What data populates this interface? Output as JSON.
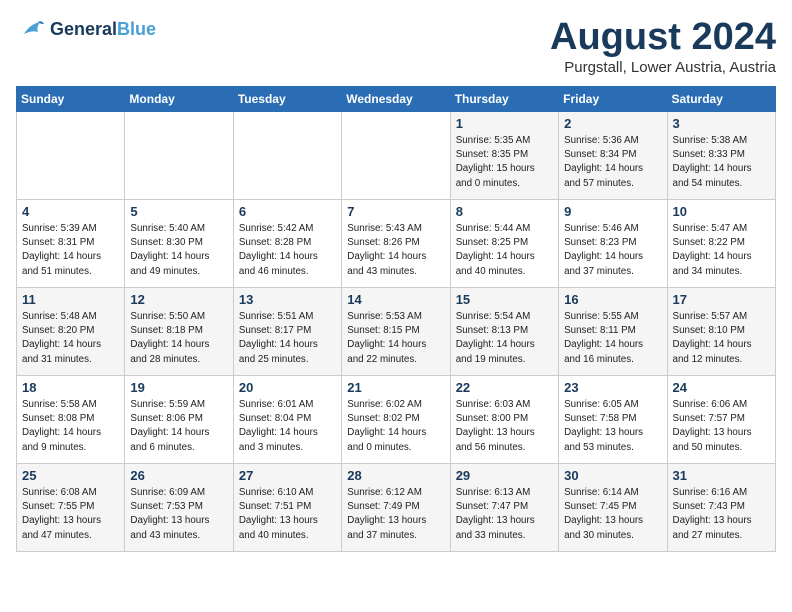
{
  "logo": {
    "line1": "General",
    "line2": "Blue"
  },
  "title": "August 2024",
  "subtitle": "Purgstall, Lower Austria, Austria",
  "weekdays": [
    "Sunday",
    "Monday",
    "Tuesday",
    "Wednesday",
    "Thursday",
    "Friday",
    "Saturday"
  ],
  "weeks": [
    [
      {
        "day": "",
        "info": ""
      },
      {
        "day": "",
        "info": ""
      },
      {
        "day": "",
        "info": ""
      },
      {
        "day": "",
        "info": ""
      },
      {
        "day": "1",
        "info": "Sunrise: 5:35 AM\nSunset: 8:35 PM\nDaylight: 15 hours\nand 0 minutes."
      },
      {
        "day": "2",
        "info": "Sunrise: 5:36 AM\nSunset: 8:34 PM\nDaylight: 14 hours\nand 57 minutes."
      },
      {
        "day": "3",
        "info": "Sunrise: 5:38 AM\nSunset: 8:33 PM\nDaylight: 14 hours\nand 54 minutes."
      }
    ],
    [
      {
        "day": "4",
        "info": "Sunrise: 5:39 AM\nSunset: 8:31 PM\nDaylight: 14 hours\nand 51 minutes."
      },
      {
        "day": "5",
        "info": "Sunrise: 5:40 AM\nSunset: 8:30 PM\nDaylight: 14 hours\nand 49 minutes."
      },
      {
        "day": "6",
        "info": "Sunrise: 5:42 AM\nSunset: 8:28 PM\nDaylight: 14 hours\nand 46 minutes."
      },
      {
        "day": "7",
        "info": "Sunrise: 5:43 AM\nSunset: 8:26 PM\nDaylight: 14 hours\nand 43 minutes."
      },
      {
        "day": "8",
        "info": "Sunrise: 5:44 AM\nSunset: 8:25 PM\nDaylight: 14 hours\nand 40 minutes."
      },
      {
        "day": "9",
        "info": "Sunrise: 5:46 AM\nSunset: 8:23 PM\nDaylight: 14 hours\nand 37 minutes."
      },
      {
        "day": "10",
        "info": "Sunrise: 5:47 AM\nSunset: 8:22 PM\nDaylight: 14 hours\nand 34 minutes."
      }
    ],
    [
      {
        "day": "11",
        "info": "Sunrise: 5:48 AM\nSunset: 8:20 PM\nDaylight: 14 hours\nand 31 minutes."
      },
      {
        "day": "12",
        "info": "Sunrise: 5:50 AM\nSunset: 8:18 PM\nDaylight: 14 hours\nand 28 minutes."
      },
      {
        "day": "13",
        "info": "Sunrise: 5:51 AM\nSunset: 8:17 PM\nDaylight: 14 hours\nand 25 minutes."
      },
      {
        "day": "14",
        "info": "Sunrise: 5:53 AM\nSunset: 8:15 PM\nDaylight: 14 hours\nand 22 minutes."
      },
      {
        "day": "15",
        "info": "Sunrise: 5:54 AM\nSunset: 8:13 PM\nDaylight: 14 hours\nand 19 minutes."
      },
      {
        "day": "16",
        "info": "Sunrise: 5:55 AM\nSunset: 8:11 PM\nDaylight: 14 hours\nand 16 minutes."
      },
      {
        "day": "17",
        "info": "Sunrise: 5:57 AM\nSunset: 8:10 PM\nDaylight: 14 hours\nand 12 minutes."
      }
    ],
    [
      {
        "day": "18",
        "info": "Sunrise: 5:58 AM\nSunset: 8:08 PM\nDaylight: 14 hours\nand 9 minutes."
      },
      {
        "day": "19",
        "info": "Sunrise: 5:59 AM\nSunset: 8:06 PM\nDaylight: 14 hours\nand 6 minutes."
      },
      {
        "day": "20",
        "info": "Sunrise: 6:01 AM\nSunset: 8:04 PM\nDaylight: 14 hours\nand 3 minutes."
      },
      {
        "day": "21",
        "info": "Sunrise: 6:02 AM\nSunset: 8:02 PM\nDaylight: 14 hours\nand 0 minutes."
      },
      {
        "day": "22",
        "info": "Sunrise: 6:03 AM\nSunset: 8:00 PM\nDaylight: 13 hours\nand 56 minutes."
      },
      {
        "day": "23",
        "info": "Sunrise: 6:05 AM\nSunset: 7:58 PM\nDaylight: 13 hours\nand 53 minutes."
      },
      {
        "day": "24",
        "info": "Sunrise: 6:06 AM\nSunset: 7:57 PM\nDaylight: 13 hours\nand 50 minutes."
      }
    ],
    [
      {
        "day": "25",
        "info": "Sunrise: 6:08 AM\nSunset: 7:55 PM\nDaylight: 13 hours\nand 47 minutes."
      },
      {
        "day": "26",
        "info": "Sunrise: 6:09 AM\nSunset: 7:53 PM\nDaylight: 13 hours\nand 43 minutes."
      },
      {
        "day": "27",
        "info": "Sunrise: 6:10 AM\nSunset: 7:51 PM\nDaylight: 13 hours\nand 40 minutes."
      },
      {
        "day": "28",
        "info": "Sunrise: 6:12 AM\nSunset: 7:49 PM\nDaylight: 13 hours\nand 37 minutes."
      },
      {
        "day": "29",
        "info": "Sunrise: 6:13 AM\nSunset: 7:47 PM\nDaylight: 13 hours\nand 33 minutes."
      },
      {
        "day": "30",
        "info": "Sunrise: 6:14 AM\nSunset: 7:45 PM\nDaylight: 13 hours\nand 30 minutes."
      },
      {
        "day": "31",
        "info": "Sunrise: 6:16 AM\nSunset: 7:43 PM\nDaylight: 13 hours\nand 27 minutes."
      }
    ]
  ]
}
